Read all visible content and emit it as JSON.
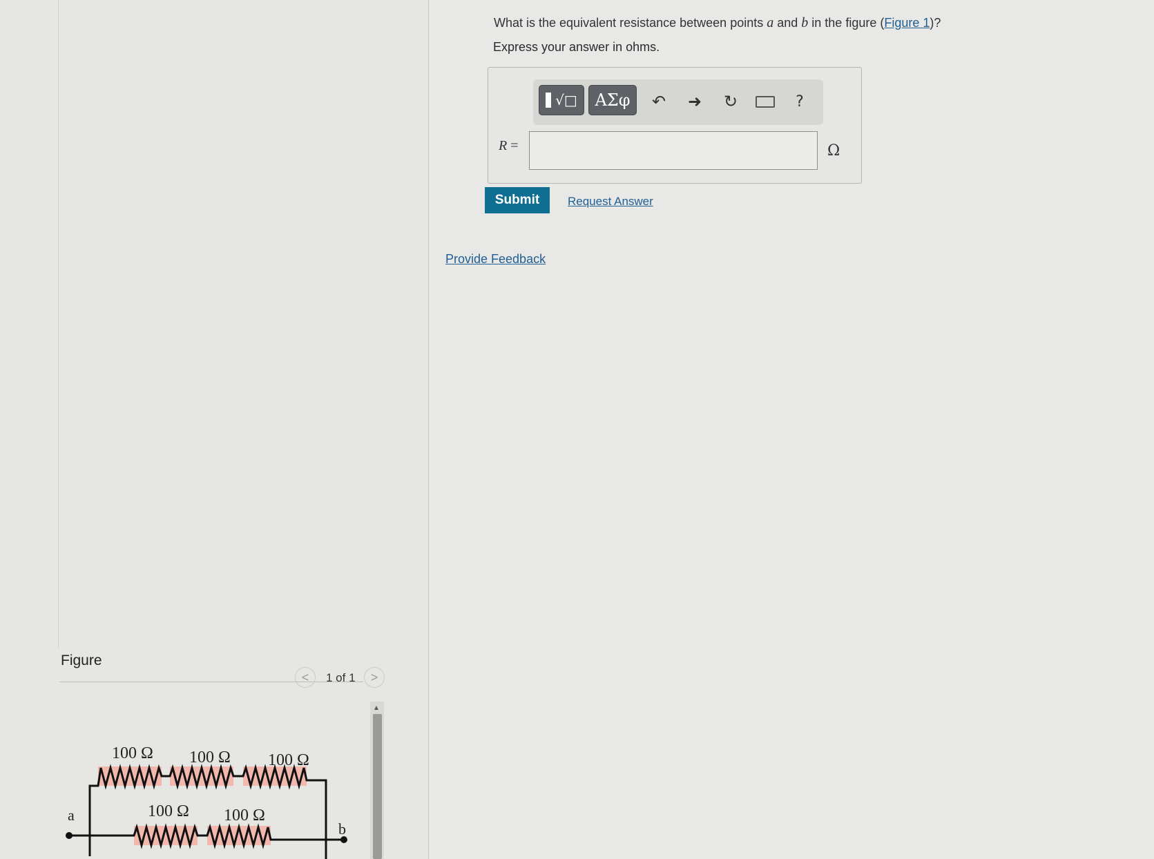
{
  "question": {
    "prefix": "What is the equivalent resistance between points ",
    "var_a": "a",
    "middle": " and ",
    "var_b": "b",
    "suffix_pre": " in the figure (",
    "figure_link": "Figure 1",
    "suffix_post": ")?"
  },
  "instruction": "Express your answer in ohms.",
  "toolbar": {
    "template_label": "√□",
    "greek_label": "ΑΣφ",
    "undo_icon": "undo-icon",
    "redo_icon": "redo-icon",
    "reset_icon": "reset-icon",
    "keyboard_icon": "keyboard-icon",
    "help_label": "?"
  },
  "answer": {
    "variable": "R",
    "equals": " =",
    "value": "",
    "unit": "Ω"
  },
  "actions": {
    "submit": "Submit",
    "request_answer": "Request Answer",
    "provide_feedback": "Provide Feedback"
  },
  "figure": {
    "label": "Figure",
    "pager": "1 of 1",
    "prev": "<",
    "next": ">",
    "top_resistors": [
      "100 Ω",
      "100 Ω",
      "100 Ω"
    ],
    "bottom_resistors": [
      "100 Ω",
      "100 Ω"
    ],
    "node_a": "a",
    "node_b": "b"
  },
  "colors": {
    "submit_bg": "#0f6f93",
    "link": "#1f5f94",
    "resistor_highlight": "#f2b8ad",
    "toolbar_button": "#5e6266"
  }
}
